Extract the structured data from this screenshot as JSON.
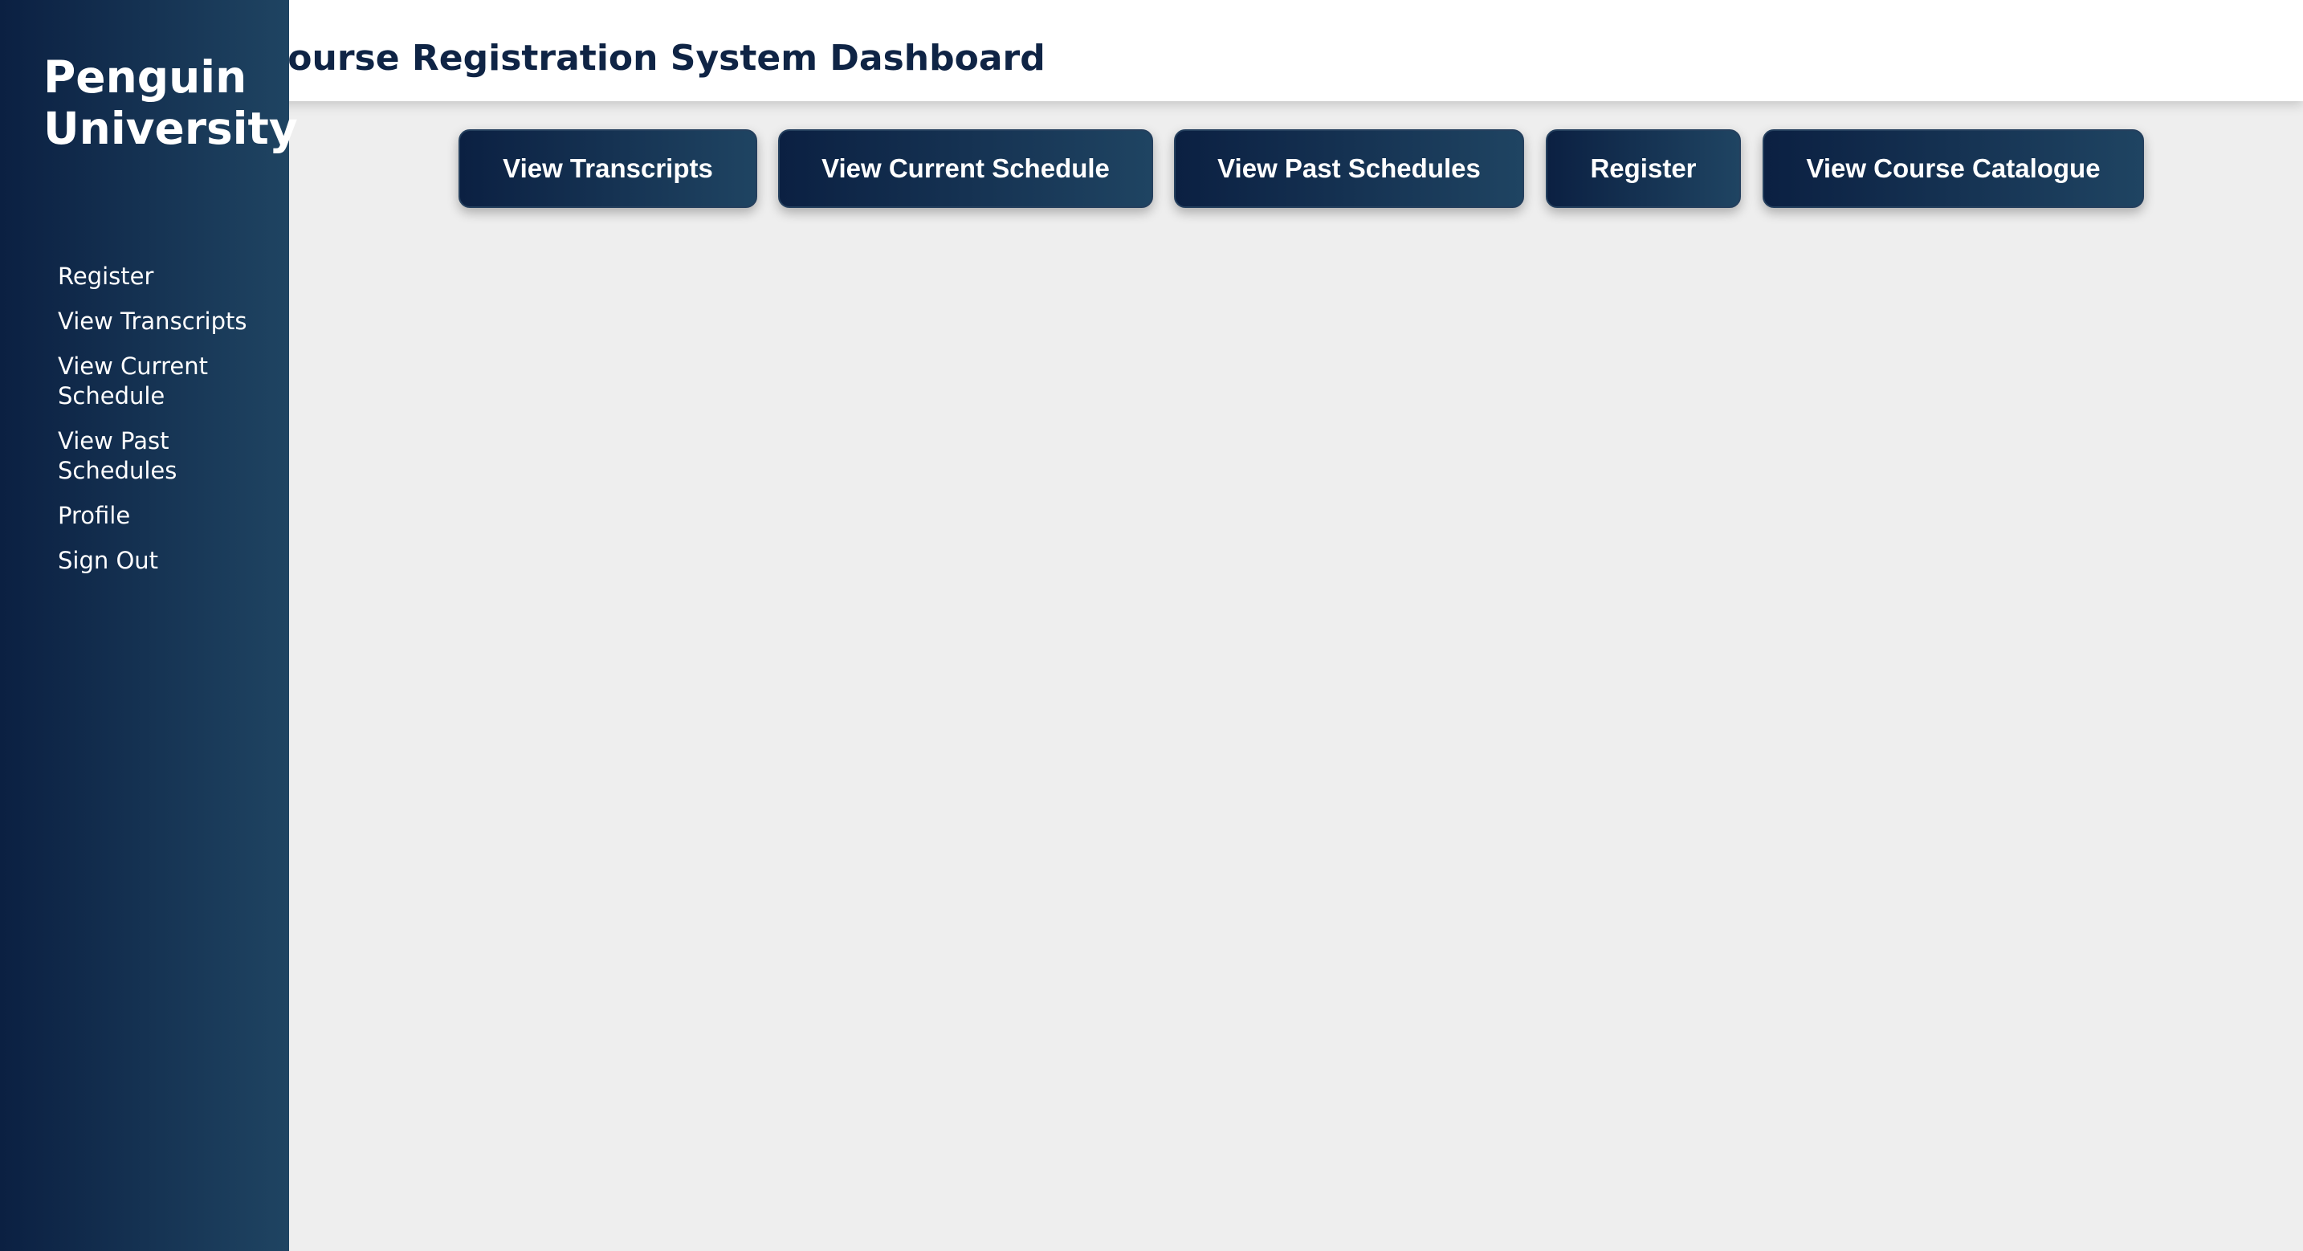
{
  "header": {
    "title": "Course Registration System Dashboard"
  },
  "sidebar": {
    "brand": "Penguin University",
    "items": [
      {
        "label": "Register"
      },
      {
        "label": "View Transcripts"
      },
      {
        "label": "View Current Schedule"
      },
      {
        "label": "View Past Schedules"
      },
      {
        "label": "Profile"
      },
      {
        "label": "Sign Out"
      }
    ]
  },
  "actions": [
    {
      "label": "View Transcripts"
    },
    {
      "label": "View Current Schedule"
    },
    {
      "label": "View Past Schedules"
    },
    {
      "label": "Register"
    },
    {
      "label": "View Course Catalogue"
    }
  ],
  "colors": {
    "sidebar_gradient_start": "#0b2042",
    "sidebar_gradient_end": "#1f4462",
    "header_text": "#0f2445",
    "page_background": "#eeeeee"
  }
}
